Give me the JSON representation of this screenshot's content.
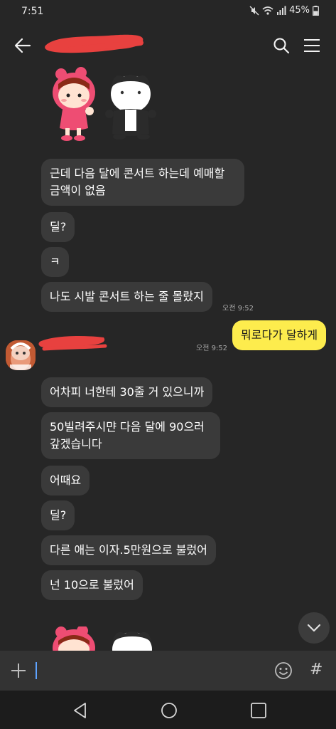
{
  "status_bar": {
    "time": "7:51",
    "battery": "45%"
  },
  "header": {
    "back_icon": "arrow-left-icon",
    "title_redacted": true,
    "search_icon": "search-icon",
    "menu_icon": "menu-icon"
  },
  "messages": {
    "m1": "근데 다음 달에 콘서트 하는데 예매할\n금액이 없음",
    "m2": "딜?",
    "m3": "ㅋ",
    "m4": "나도 시발 콘서트 하는 줄 몰랐지",
    "m4_time": "오전 9:52",
    "m5": "뭐로다가 달하게",
    "m5_time": "오전 9:52",
    "m6": "어차피 너한테 30줄 거 있으니까",
    "m7": "50빌려주시먄 다음 달에 90으러\n갚겠습니다",
    "m8": "어때요",
    "m9": "딜?",
    "m10": "다른 애는 이자.5만원으로 불렀어",
    "m11": "넌 10으로 불렀어"
  },
  "sender": {
    "name_redacted": true
  },
  "input": {
    "placeholder": ""
  },
  "colors": {
    "background": "#262626",
    "bubble_other": "#3a3a3a",
    "bubble_mine": "#fdec4d",
    "redaction": "#e8413f"
  }
}
